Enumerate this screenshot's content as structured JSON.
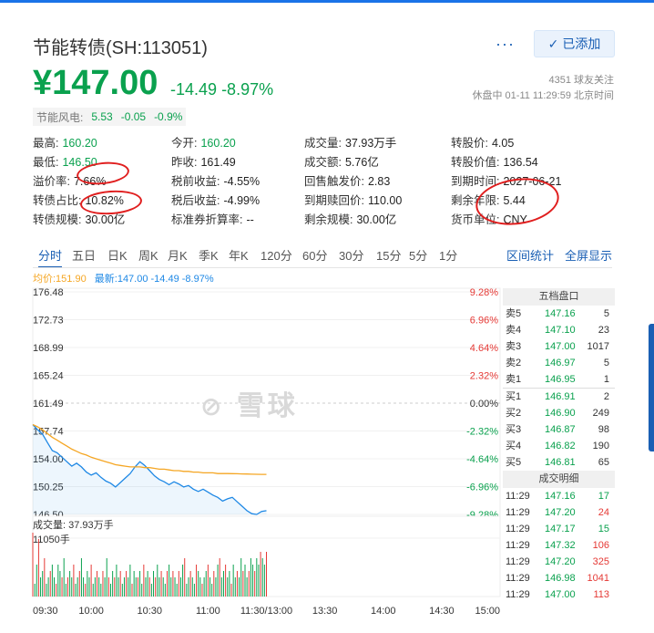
{
  "header": {
    "title": "节能转债(SH:113051)",
    "more_label": "···",
    "added_label": "已添加",
    "price": "¥147.00",
    "change": "-14.49",
    "change_pct": "-8.97%",
    "followers": "4351 球友关注",
    "status_time": "休盘中 01-11 11:29:59 北京时间"
  },
  "related": {
    "name": "节能风电:",
    "price": "5.53",
    "change": "-0.05",
    "pct": "-0.9%"
  },
  "stats": [
    {
      "k": "最高:",
      "v": "160.20",
      "c": "green"
    },
    {
      "k": "今开:",
      "v": "160.20",
      "c": "green"
    },
    {
      "k": "成交量:",
      "v": "37.93万手",
      "c": ""
    },
    {
      "k": "转股价:",
      "v": "4.05",
      "c": ""
    },
    {
      "k": "最低:",
      "v": "146.50",
      "c": "green"
    },
    {
      "k": "昨收:",
      "v": "161.49",
      "c": ""
    },
    {
      "k": "成交额:",
      "v": "5.76亿",
      "c": ""
    },
    {
      "k": "转股价值:",
      "v": "136.54",
      "c": ""
    },
    {
      "k": "溢价率:",
      "v": "7.66%",
      "c": ""
    },
    {
      "k": "税前收益:",
      "v": "-4.55%",
      "c": ""
    },
    {
      "k": "回售触发价:",
      "v": "2.83",
      "c": ""
    },
    {
      "k": "到期时间:",
      "v": "2027-06-21",
      "c": ""
    },
    {
      "k": "转债占比:",
      "v": "10.82%",
      "c": ""
    },
    {
      "k": "税后收益:",
      "v": "-4.99%",
      "c": ""
    },
    {
      "k": "到期赎回价:",
      "v": "110.00",
      "c": ""
    },
    {
      "k": "剩余年限:",
      "v": "5.44",
      "c": ""
    },
    {
      "k": "转债规模:",
      "v": "30.00亿",
      "c": ""
    },
    {
      "k": "标准券折算率:",
      "v": "--",
      "c": ""
    },
    {
      "k": "剩余规模:",
      "v": "30.00亿",
      "c": ""
    },
    {
      "k": "货币单位:",
      "v": "CNY",
      "c": ""
    }
  ],
  "tabs": [
    "分时",
    "五日",
    "日K",
    "周K",
    "月K",
    "季K",
    "年K",
    "120分",
    "60分",
    "30分",
    "15分",
    "5分",
    "1分"
  ],
  "tabs_right": [
    "区间统计",
    "全屏显示"
  ],
  "legend": {
    "avg": "均价:151.90",
    "latest": "最新:147.00 -14.49 -8.97%"
  },
  "watermark": "雪球",
  "colors": {
    "green": "#0aa14e",
    "red": "#e53935",
    "price_line": "#1e88e5",
    "avg_line": "#f5a623",
    "accent": "#1a5fb4"
  },
  "chart_data": {
    "type": "line",
    "ylabels_left": [
      "176.48",
      "172.73",
      "168.99",
      "165.24",
      "161.49",
      "157.74",
      "154.00",
      "150.25",
      "146.50"
    ],
    "ylabels_right": [
      "9.28%",
      "6.96%",
      "4.64%",
      "2.32%",
      "0.00%",
      "-2.32%",
      "-4.64%",
      "-6.96%",
      "-9.28%"
    ],
    "ylim": [
      146.5,
      176.48
    ],
    "x_ticks": [
      "09:30",
      "10:00",
      "10:30",
      "11:00",
      "11:30/13:00",
      "13:30",
      "14:00",
      "14:30",
      "15:00"
    ],
    "series": [
      {
        "name": "最新",
        "values": [
          158.6,
          157.9,
          157.3,
          156.2,
          155.1,
          154.8,
          154.2,
          153.6,
          153.0,
          153.4,
          152.9,
          152.2,
          151.8,
          152.1,
          151.5,
          151.0,
          150.7,
          150.2,
          150.8,
          151.4,
          152.0,
          152.9,
          153.6,
          153.1,
          152.4,
          151.7,
          151.2,
          150.9,
          150.5,
          150.9,
          150.6,
          150.2,
          150.4,
          149.9,
          149.6,
          149.9,
          149.5,
          149.1,
          148.8,
          148.3,
          148.6,
          148.8,
          148.2,
          147.6,
          147.0,
          146.6,
          146.5,
          146.9,
          147.0
        ]
      },
      {
        "name": "均价",
        "values": [
          158.6,
          158.3,
          157.9,
          157.4,
          156.9,
          156.5,
          156.1,
          155.7,
          155.3,
          155.0,
          154.7,
          154.5,
          154.2,
          154.0,
          153.8,
          153.6,
          153.4,
          153.2,
          153.1,
          153.0,
          152.9,
          152.9,
          152.9,
          152.8,
          152.8,
          152.7,
          152.6,
          152.6,
          152.5,
          152.4,
          152.4,
          152.3,
          152.3,
          152.2,
          152.2,
          152.1,
          152.1,
          152.1,
          152.0,
          152.0,
          152.0,
          151.99,
          151.98,
          151.96,
          151.94,
          151.92,
          151.91,
          151.9,
          151.9
        ]
      }
    ],
    "volume_label": "成交量: 37.93万手",
    "volume_max_label": "11050手",
    "volume": [
      10,
      2,
      5,
      9,
      3,
      4,
      6,
      2,
      3,
      4,
      5,
      3,
      2,
      5,
      4,
      3,
      6,
      2,
      3,
      4,
      3,
      5,
      2,
      3,
      4,
      6,
      3,
      2,
      4,
      3,
      5,
      2,
      3,
      4,
      3,
      2,
      4,
      3,
      6,
      3,
      2,
      4,
      3,
      5,
      3,
      4,
      2,
      3,
      4,
      3,
      5,
      2,
      4,
      3,
      3,
      4,
      2,
      5,
      3,
      4,
      3,
      2,
      4,
      3,
      5,
      3,
      4,
      3,
      2,
      4,
      5,
      3,
      4,
      3,
      2,
      4,
      3,
      5,
      6,
      2,
      3,
      4,
      3,
      2,
      5,
      4,
      3,
      2,
      3,
      4,
      5,
      3,
      2,
      4,
      3,
      5,
      6,
      3,
      4,
      5,
      3,
      4,
      2,
      5,
      3,
      4,
      3,
      6,
      4,
      5,
      3,
      4,
      6,
      5,
      4,
      6,
      5,
      7,
      6,
      5,
      7
    ],
    "order_book": {
      "header": "五档盘口",
      "asks": [
        [
          "卖5",
          "147.16",
          "5"
        ],
        [
          "卖4",
          "147.10",
          "23"
        ],
        [
          "卖3",
          "147.00",
          "1017"
        ],
        [
          "卖2",
          "146.97",
          "5"
        ],
        [
          "卖1",
          "146.95",
          "1"
        ]
      ],
      "bids": [
        [
          "买1",
          "146.91",
          "2"
        ],
        [
          "买2",
          "146.90",
          "249"
        ],
        [
          "买3",
          "146.87",
          "98"
        ],
        [
          "买4",
          "146.82",
          "190"
        ],
        [
          "买5",
          "146.81",
          "65"
        ]
      ]
    },
    "trades": {
      "header": "成交明细",
      "rows": [
        [
          "11:29",
          "147.16",
          "17",
          "b"
        ],
        [
          "11:29",
          "147.20",
          "24",
          "r"
        ],
        [
          "11:29",
          "147.17",
          "15",
          "b"
        ],
        [
          "11:29",
          "147.32",
          "106",
          "r"
        ],
        [
          "11:29",
          "147.20",
          "325",
          "r"
        ],
        [
          "11:29",
          "146.98",
          "1041",
          "r"
        ],
        [
          "11:29",
          "147.00",
          "113",
          "r"
        ]
      ]
    }
  }
}
